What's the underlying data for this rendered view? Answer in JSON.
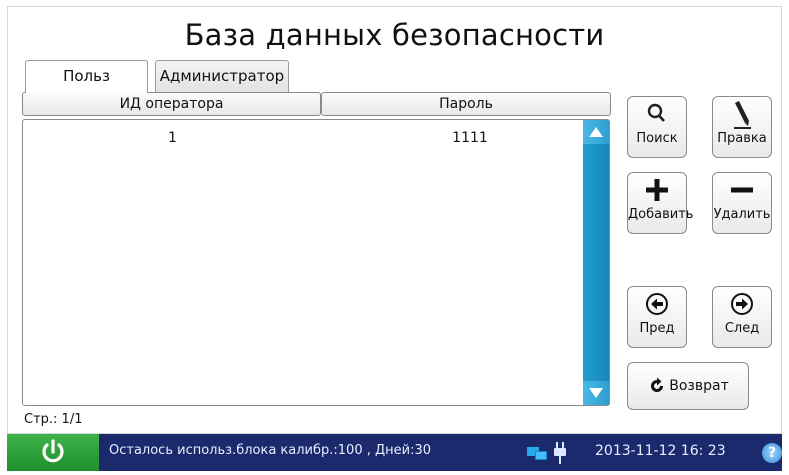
{
  "title": "База данных безопасности",
  "tabs": [
    {
      "label": "Польз",
      "active": true
    },
    {
      "label": "Администратор",
      "active": false
    }
  ],
  "table": {
    "columns": [
      "ИД оператора",
      "Пароль"
    ],
    "rows": [
      {
        "id": "1",
        "password": "1111"
      }
    ]
  },
  "buttons": {
    "search": "Поиск",
    "edit": "Правка",
    "add": "Добавить",
    "delete": "Удалить",
    "prev": "Пред",
    "next": "След",
    "back": "Возврат"
  },
  "icons": {
    "search": "magnifier-icon",
    "edit": "pencil-icon",
    "add": "plus-icon",
    "delete": "minus-icon",
    "prev": "arrow-left-circle-icon",
    "next": "arrow-right-circle-icon",
    "back": "return-arrow-icon",
    "power": "power-icon",
    "network": "network-icon",
    "plug": "plug-icon",
    "help": "help-icon"
  },
  "pagination": {
    "label": "Стр.:  1/1"
  },
  "status": {
    "message": "Осталось использ.блока калибр.:100 , Дней:30",
    "datetime": "2013-11-12  16: 23",
    "help": "?"
  },
  "colors": {
    "statusbar": "#1a2a6c",
    "power": "#2ea23b",
    "scrollbar": "#1f9fd0"
  }
}
